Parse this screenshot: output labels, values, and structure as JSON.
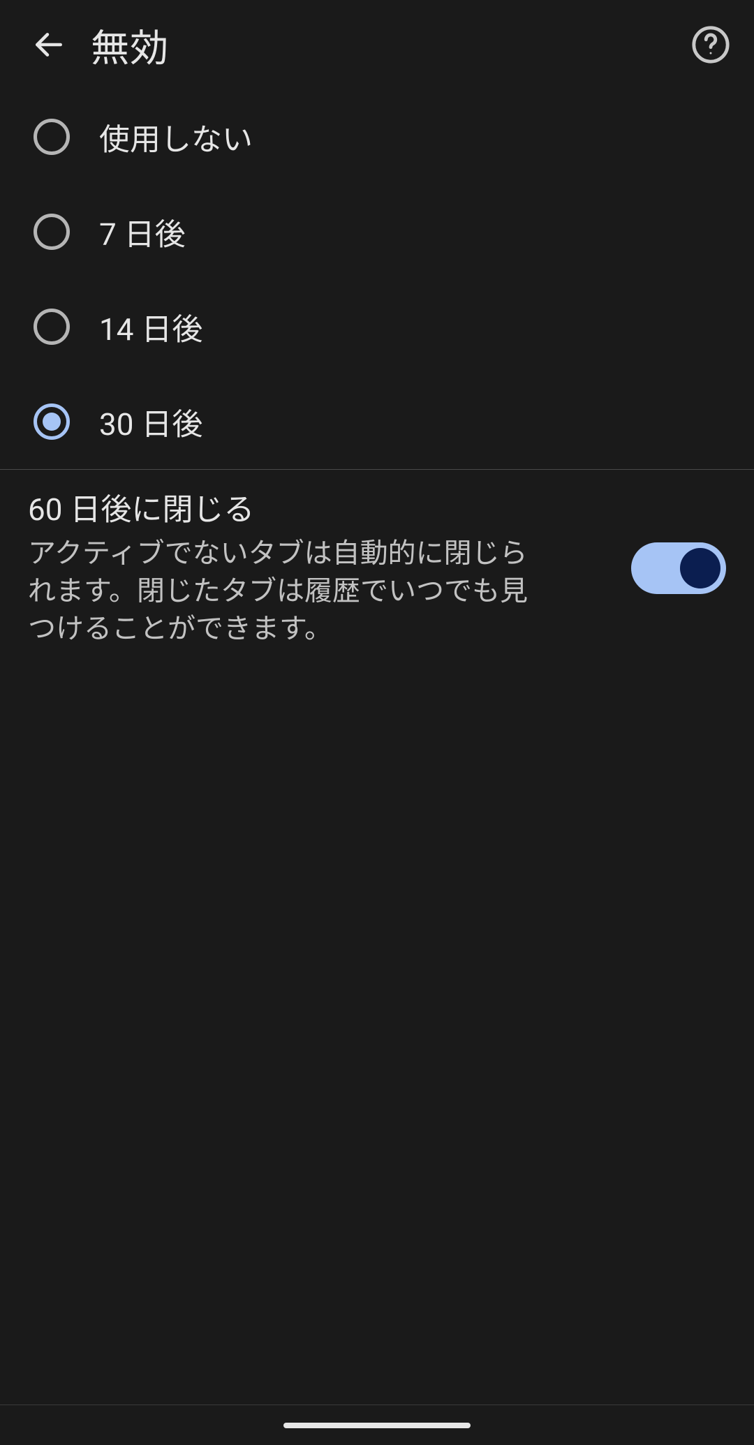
{
  "header": {
    "title": "無効"
  },
  "options": [
    {
      "label": "使用しない",
      "selected": false
    },
    {
      "label": "7 日後",
      "selected": false
    },
    {
      "label": "14 日後",
      "selected": false
    },
    {
      "label": "30 日後",
      "selected": true
    }
  ],
  "close_setting": {
    "title": "60 日後に閉じる",
    "description": "アクティブでないタブは自動的に閉じられます。閉じたタブは履歴でいつでも見つけることができます。",
    "enabled": true
  }
}
